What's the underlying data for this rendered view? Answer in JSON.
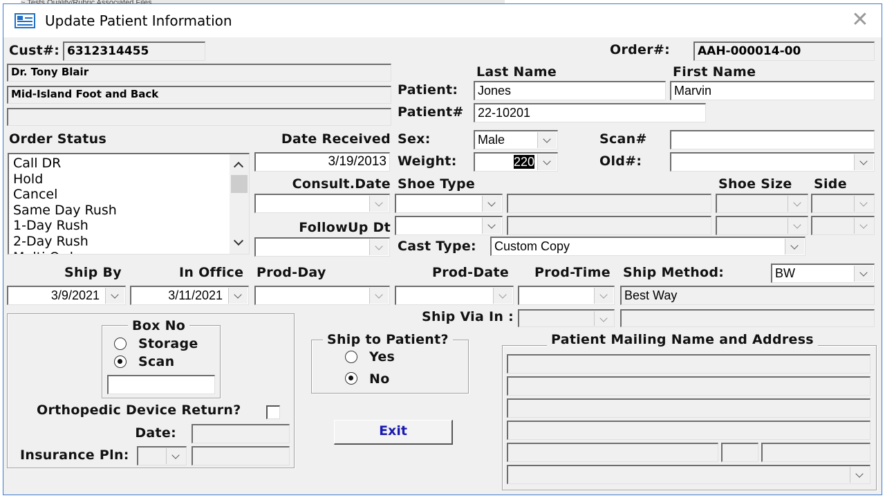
{
  "window": {
    "title": "Update Patient Information"
  },
  "background_strip": "~ Tests   Quality/Rubric   Associated Files",
  "customer": {
    "cust_label": "Cust#:",
    "cust_value": "6312314455",
    "doctor": "Dr. Tony Blair",
    "practice": "Mid-Island Foot and Back",
    "line3": ""
  },
  "order": {
    "order_label": "Order#:",
    "order_value": "AAH-000014-00"
  },
  "patient": {
    "last_name_header": "Last Name",
    "first_name_header": "First Name",
    "patient_label": "Patient:",
    "last_name": "Jones",
    "first_name": "Marvin",
    "patient_no_label": "Patient#",
    "patient_no": "22-10201",
    "sex_label": "Sex:",
    "sex": "Male",
    "weight_label": "Weight:",
    "weight": "220",
    "scan_label": "Scan#",
    "scan": "",
    "old_label": "Old#:",
    "old": ""
  },
  "order_status": {
    "label": "Order Status",
    "items": [
      "Call DR",
      "Hold",
      "Cancel",
      "Same Day Rush",
      "1-Day Rush",
      "2-Day Rush",
      "Multi Orders"
    ]
  },
  "dates": {
    "date_received_label": "Date Received",
    "date_received": "3/19/2013",
    "consult_label": "Consult.Date",
    "consult": "",
    "followup_label": "FollowUp Dt",
    "followup": ""
  },
  "shoe": {
    "shoe_type_label": "Shoe Type",
    "shoe_size_label": "Shoe Size",
    "side_label": "Side",
    "cast_type_label": "Cast Type:",
    "cast_type": "Custom Copy"
  },
  "shipping": {
    "ship_by_label": "Ship By",
    "ship_by": "3/9/2021",
    "in_office_label": "In Office",
    "in_office": "3/11/2021",
    "prod_day_label": "Prod-Day",
    "prod_date_label": "Prod-Date",
    "prod_time_label": "Prod-Time",
    "ship_method_label": "Ship Method:",
    "ship_method_code": "BW",
    "ship_method_desc": "Best Way",
    "ship_via_label": "Ship Via In :"
  },
  "box_no": {
    "label": "Box No",
    "options": [
      "Storage",
      "Scan"
    ],
    "selected": "Scan",
    "value": ""
  },
  "ortho": {
    "return_label": "Orthopedic Device Return?",
    "date_label": "Date:",
    "insurance_label": "Insurance Pln:"
  },
  "ship_to_patient": {
    "label": "Ship to Patient?",
    "options": [
      "Yes",
      "No"
    ],
    "selected": "No"
  },
  "mailing": {
    "label": "Patient Mailing Name and Address"
  },
  "buttons": {
    "exit": "Exit"
  }
}
